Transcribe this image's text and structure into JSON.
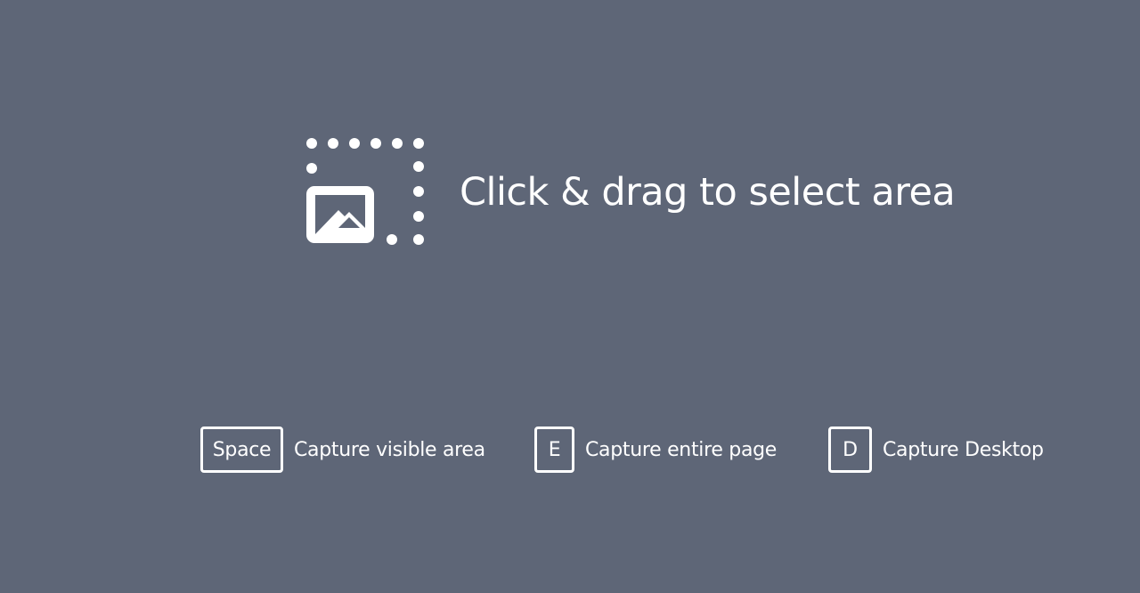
{
  "hero": {
    "icon": "select-area-icon",
    "prompt": "Click & drag to select area"
  },
  "shortcuts": [
    {
      "key": "Space",
      "label": "Capture visible area"
    },
    {
      "key": "E",
      "label": "Capture entire page"
    },
    {
      "key": "D",
      "label": "Capture Desktop"
    }
  ],
  "colors": {
    "background": "#5e6677",
    "foreground": "#ffffff"
  }
}
